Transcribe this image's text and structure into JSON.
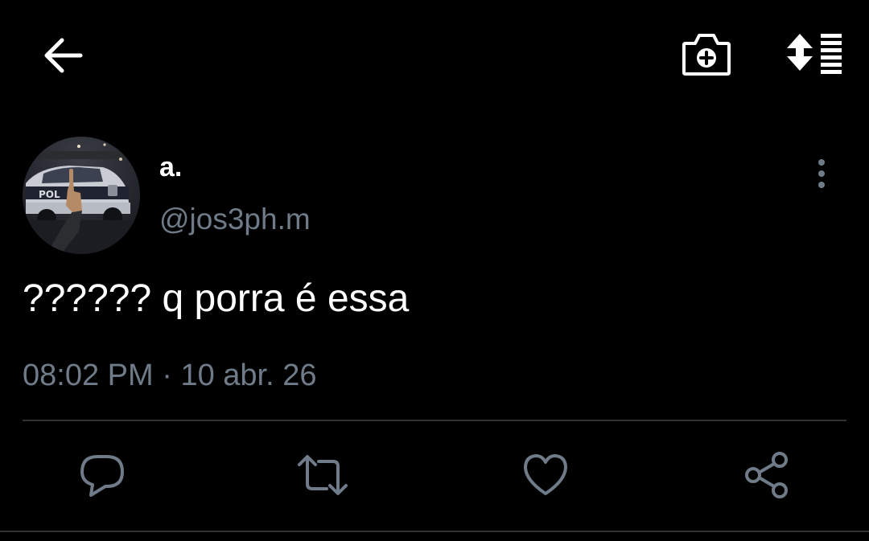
{
  "header": {
    "back_icon": "arrow-left-icon",
    "camera_icon": "camera-plus-icon",
    "sort_icon": "sort-list-icon"
  },
  "tweet": {
    "display_name": "a.",
    "handle": "@jos3ph.m",
    "text": "?????? q porra é essa",
    "time": "08:02 PM",
    "separator": "·",
    "date": "10 abr. 26",
    "more_icon": "more-vertical-icon"
  },
  "actions": {
    "reply_icon": "reply-icon",
    "retweet_icon": "retweet-icon",
    "like_icon": "heart-icon",
    "share_icon": "share-icon"
  },
  "colors": {
    "background": "#000000",
    "primary_text": "#ffffff",
    "secondary_text": "#6f7b88",
    "divider": "#2f3336"
  }
}
